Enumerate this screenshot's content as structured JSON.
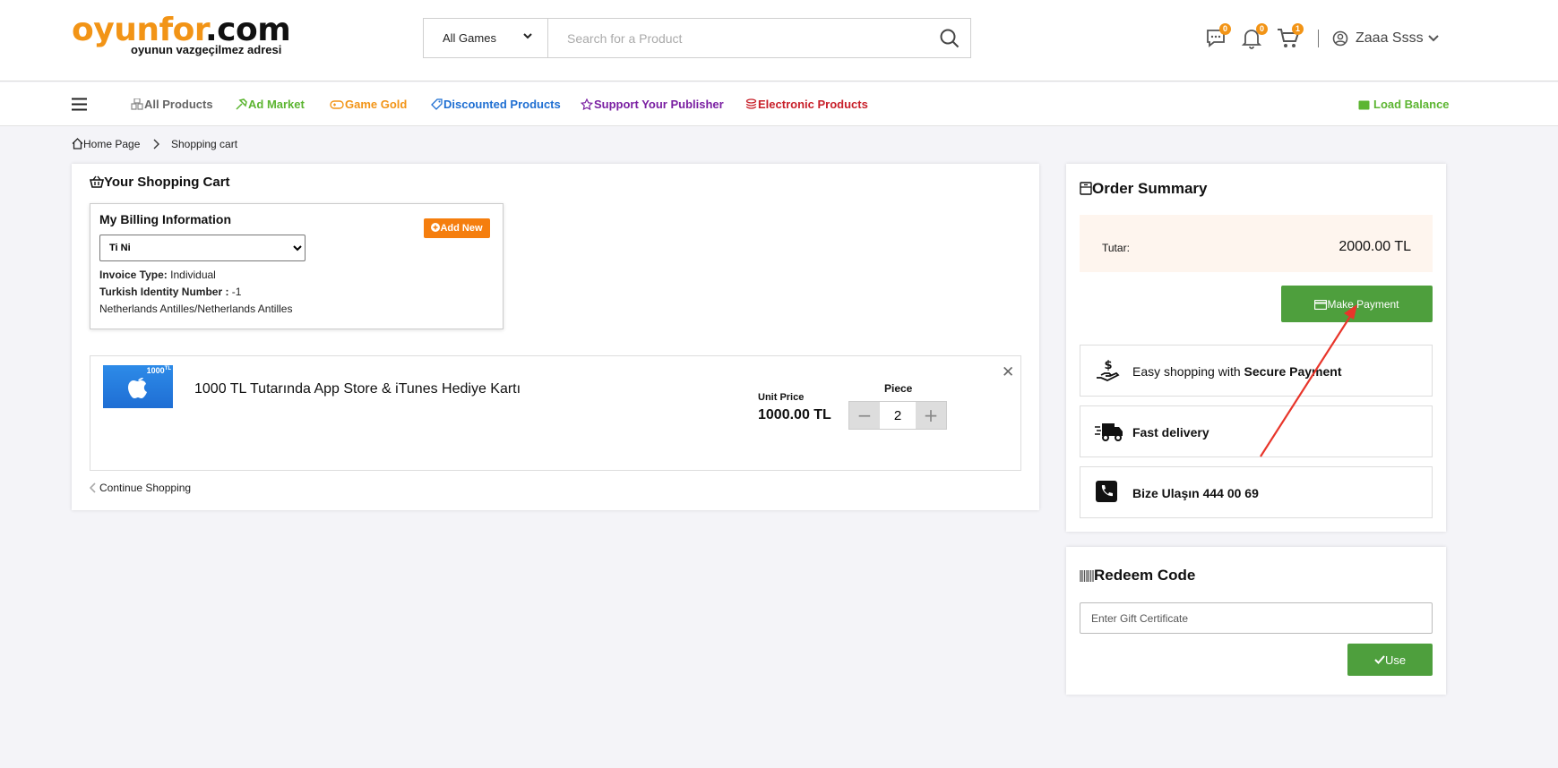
{
  "header": {
    "logo_main_orange": "oyunfor",
    "logo_main_dark": ".com",
    "logo_tagline": "oyunun vazgeçilmez adresi",
    "game_select": "All Games",
    "search_placeholder": "Search for a Product",
    "messages_count": "0",
    "notifications_count": "0",
    "cart_count": "1",
    "user_name": "Zaaa Ssss"
  },
  "nav": {
    "items": [
      {
        "label": "All Products",
        "color": "#666666"
      },
      {
        "label": "Ad Market",
        "color": "#5cb531"
      },
      {
        "label": "Game Gold",
        "color": "#f29416"
      },
      {
        "label": "Discounted Products",
        "color": "#1f6fd2"
      },
      {
        "label": "Support Your Publisher",
        "color": "#7a1fa2"
      },
      {
        "label": "Electronic Products",
        "color": "#c8202a"
      }
    ],
    "load_balance": "Load Balance",
    "load_balance_color": "#5cb531"
  },
  "breadcrumb": {
    "home": "Home Page",
    "current": "Shopping cart"
  },
  "cart": {
    "title": "Your Shopping Cart",
    "billing": {
      "title": "My Billing Information",
      "add_new": "Add New",
      "selected": "Ti Ni",
      "invoice_type_label": "Invoice Type:",
      "invoice_type_value": " Individual",
      "identity_label": "Turkish Identity Number :",
      "identity_value": " -1",
      "address": "Netherlands Antilles/Netherlands Antilles"
    },
    "item": {
      "image_tag": "1000",
      "name": "1000 TL Tutarında App Store & iTunes Hediye Kartı",
      "unit_price_label": "Unit Price",
      "unit_price": "1000.00 TL",
      "piece_label": "Piece",
      "quantity": "2"
    },
    "continue": "Continue Shopping"
  },
  "summary": {
    "title": "Order Summary",
    "amount_label": "Tutar:",
    "amount_value": "2000.00 TL",
    "pay_button": "Make Payment",
    "feature_1_prefix": "Easy shopping with ",
    "feature_1_bold": "Secure Payment",
    "feature_2": "Fast delivery",
    "feature_3": "Bize Ulaşın 444 00 69"
  },
  "redeem": {
    "title": "Redeem Code",
    "placeholder": "Enter Gift Certificate",
    "use_button": "Use"
  },
  "colors": {
    "brand_orange": "#f29416",
    "pay_green": "#4e9f3d",
    "annotation_red": "#e8352a"
  }
}
